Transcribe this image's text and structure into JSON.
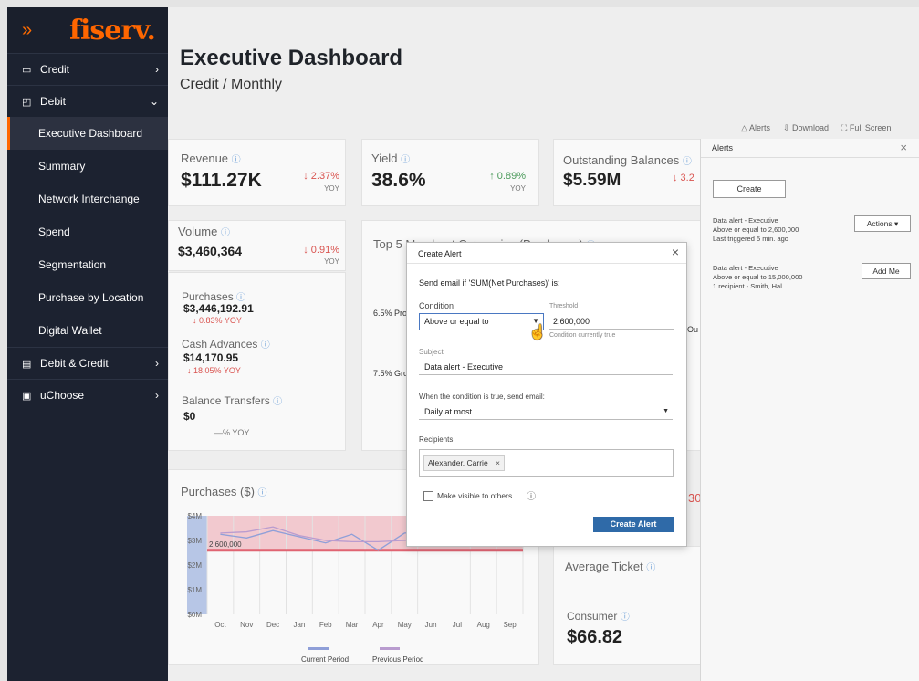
{
  "sidebar": {
    "brand_chevrons": "»",
    "brand_logo": "fiserv.",
    "items": [
      {
        "label": "Credit",
        "icon": "credit-card-icon",
        "arrow": "›"
      },
      {
        "label": "Debit",
        "icon": "wallet-icon",
        "arrow": "⌄"
      },
      {
        "label": "Debit & Credit",
        "icon": "calculator-icon",
        "arrow": "›"
      },
      {
        "label": "uChoose",
        "icon": "gift-icon",
        "arrow": "›"
      }
    ],
    "debit_subitems": [
      "Executive Dashboard",
      "Summary",
      "Network Interchange",
      "Spend",
      "Segmentation",
      "Purchase by Location",
      "Digital Wallet"
    ]
  },
  "header": {
    "title": "Executive Dashboard",
    "subtitle": "Credit / Monthly"
  },
  "toolbar": {
    "alerts": "Alerts",
    "download": "Download",
    "fullscreen": "Full Screen"
  },
  "kpis": {
    "revenue": {
      "label": "Revenue",
      "value": "$111.27K",
      "delta": "↓ 2.37%",
      "yoy": "YOY"
    },
    "yield": {
      "label": "Yield",
      "value": "38.6%",
      "delta": "↑ 0.89%",
      "yoy": "YOY"
    },
    "outstanding": {
      "label": "Outstanding Balances",
      "value": "$5.59M",
      "delta": "↓ 3.2"
    },
    "volume": {
      "label": "Volume",
      "value": "$3,460,364",
      "delta": "↓ 0.91%",
      "yoy": "YOY"
    }
  },
  "breakdown": {
    "purchases": {
      "label": "Purchases",
      "value": "$3,446,192.91",
      "delta": "↓ 0.83% YOY"
    },
    "cash_advances": {
      "label": "Cash Advances",
      "value": "$14,170.95",
      "delta": "↓ 18.05% YOY"
    },
    "balance_transfers": {
      "label": "Balance Transfers",
      "value": "$0",
      "delta": "—% YOY"
    }
  },
  "top5": {
    "title": "Top 5 Merchant Categories (Purchases)",
    "row1": "6.5% Pro",
    "row2": "7.5% Gro",
    "right_cut": "Ou"
  },
  "purchases_chart_title": "Purchases ($)",
  "avg_ticket": {
    "title": "Average Ticket",
    "consumer_label": "Consumer",
    "consumer_value": "$66.82",
    "cut_value": "30"
  },
  "alerts_panel": {
    "title": "Alerts",
    "create_button": "Create",
    "alerts": [
      {
        "name": "Data alert - Executive",
        "condition": "Above or equal to 2,600,000",
        "meta": "Last triggered 5 min. ago",
        "button": "Actions ▾"
      },
      {
        "name": "Data alert - Executive",
        "condition": "Above or equal to 15,000,000",
        "meta": "1 recipient - Smith, Hal",
        "button": "Add Me"
      }
    ]
  },
  "modal": {
    "title": "Create Alert",
    "intro": "Send email if 'SUM(Net Purchases)' is:",
    "condition_label": "Condition",
    "condition_value": "Above or equal to",
    "threshold_label": "Threshold",
    "threshold_value": "2,600,000",
    "threshold_note": "Condition currently true",
    "subject_label": "Subject",
    "subject_value": "Data alert - Executive",
    "frequency_label": "When the condition is true, send email:",
    "frequency_value": "Daily at most",
    "recipients_label": "Recipients",
    "recipient_chip": "Alexander, Carrie",
    "visible_label": "Make visible to others",
    "submit": "Create Alert"
  },
  "chart_data": {
    "type": "line",
    "title": "Purchases ($)",
    "categories": [
      "Oct",
      "Nov",
      "Dec",
      "Jan",
      "Feb",
      "Mar",
      "Apr",
      "May",
      "Jun",
      "Jul",
      "Aug",
      "Sep"
    ],
    "yticks": [
      "$0M",
      "$1M",
      "$2M",
      "$3M",
      "$4M"
    ],
    "ylim": [
      0,
      4
    ],
    "threshold": {
      "label": "2,600,000",
      "value": 2.6
    },
    "series": [
      {
        "name": "Current Period",
        "color": "#8f9fd8",
        "values": [
          3.25,
          3.1,
          3.4,
          3.15,
          2.9,
          3.25,
          2.6,
          3.3,
          3.35,
          3.2,
          3.3,
          3.3
        ]
      },
      {
        "name": "Previous Period",
        "color": "#b99ccf",
        "values": [
          3.3,
          3.35,
          3.55,
          3.2,
          3.0,
          2.95,
          2.95,
          3.0,
          3.1,
          3.1,
          3.2,
          3.2
        ]
      }
    ],
    "legend": "bottom"
  }
}
